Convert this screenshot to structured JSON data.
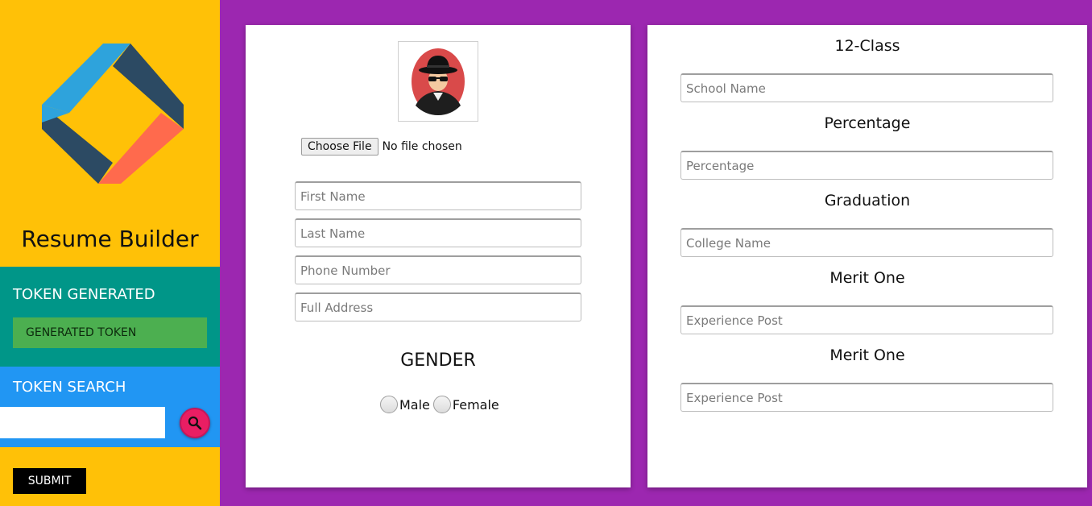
{
  "sidebar": {
    "app_title": "Resume Builder",
    "token_generated": {
      "title": "TOKEN GENERATED",
      "value": "GENERATED TOKEN"
    },
    "token_search": {
      "title": "TOKEN SEARCH",
      "input_value": "",
      "search_icon": "search-icon"
    },
    "submit_label": "SUBMIT"
  },
  "personal": {
    "file_button_label": "Choose File",
    "file_status": "No file chosen",
    "first_name_placeholder": "First Name",
    "last_name_placeholder": "Last Name",
    "phone_placeholder": "Phone Number",
    "address_placeholder": "Full Address",
    "gender_title": "GENDER",
    "gender_options": [
      "Male",
      "Female"
    ]
  },
  "education": {
    "class12_label": "12-Class",
    "school_placeholder": "School Name",
    "percentage_label": "Percentage",
    "percentage_placeholder": "Percentage",
    "graduation_label": "Graduation",
    "college_placeholder": "College Name",
    "merit1_label": "Merit One",
    "merit1_placeholder": "Experience Post",
    "merit2_label": "Merit One",
    "merit2_placeholder": "Experience Post"
  },
  "colors": {
    "background": "#9c27b0",
    "sidebar": "#ffc107",
    "token_generated_bg": "#009688",
    "token_value_bg": "#4caf50",
    "token_search_bg": "#2196f3",
    "search_button": "#e91e63",
    "submit_button": "#000000"
  }
}
